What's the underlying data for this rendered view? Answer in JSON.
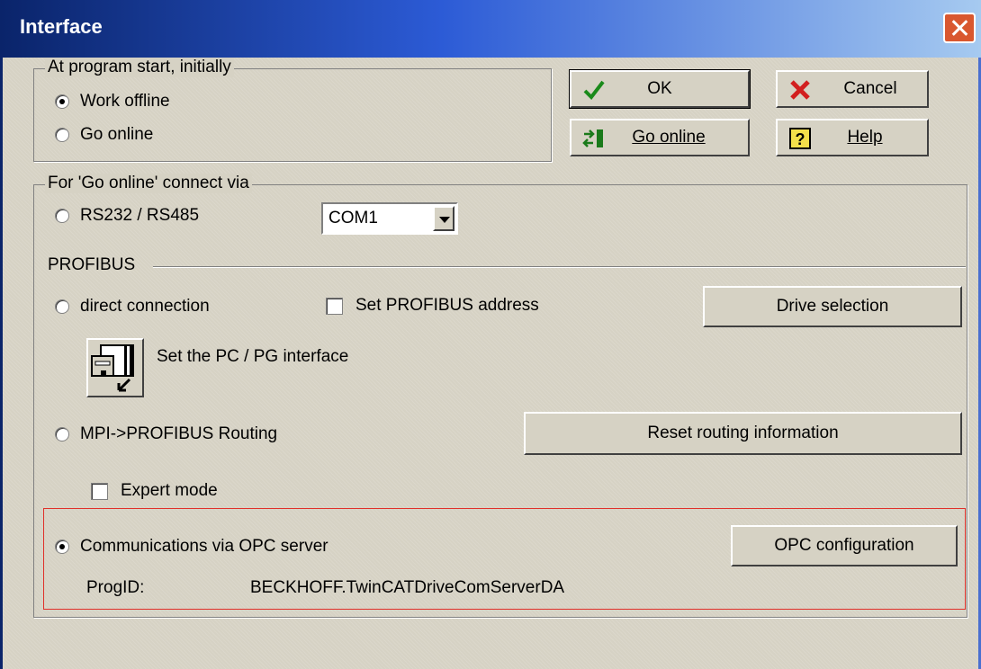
{
  "window": {
    "title": "Interface"
  },
  "startup": {
    "group_label": "At program start, initially",
    "work_offline": "Work offline",
    "go_online": "Go online"
  },
  "buttons": {
    "ok": "OK",
    "cancel": "Cancel",
    "go_online": "Go online",
    "help": "Help"
  },
  "connect": {
    "group_label": "For 'Go online' connect via",
    "rs232": "RS232 / RS485",
    "com_port": "COM1"
  },
  "profibus": {
    "label": "PROFIBUS",
    "direct_connection": "direct connection",
    "set_address": "Set PROFIBUS address",
    "drive_selection": "Drive selection",
    "set_pc_pg": "Set the PC / PG interface",
    "mpi_routing": "MPI->PROFIBUS Routing",
    "reset_routing": "Reset routing information",
    "expert_mode": "Expert mode"
  },
  "opc": {
    "communications": "Communications via OPC server",
    "configuration": "OPC configuration",
    "progid_label": "ProgID:",
    "progid_value": "BECKHOFF.TwinCATDriveComServerDA"
  },
  "colors": {
    "title_bar": "#0a246a",
    "highlight_box": "#e0302a",
    "dialog_bg": "#d6d2c4"
  },
  "icons": [
    "close-icon",
    "checkmark-icon",
    "cancel-x-icon",
    "go-online-icon",
    "help-icon",
    "pc-pg-interface-icon"
  ]
}
